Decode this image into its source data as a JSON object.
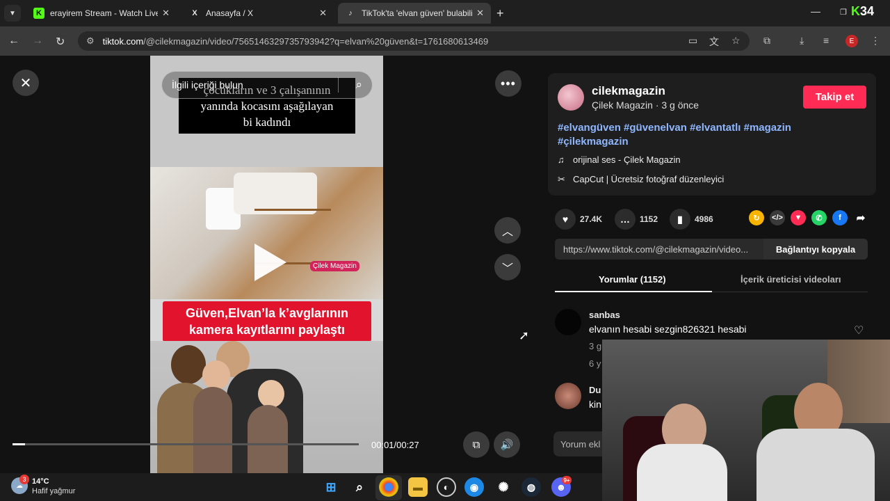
{
  "browser": {
    "tabs": [
      {
        "title": "erayirem Stream - Watch Live o",
        "favicon": "K",
        "favicon_color": "#53fc18"
      },
      {
        "title": "Anasayfa / X",
        "favicon": "X",
        "favicon_color": "#ffffff"
      },
      {
        "title": "TikTok'ta 'elvan güven' bulabilir",
        "favicon": "♪",
        "favicon_color": "#ffffff"
      }
    ],
    "url_host": "tiktok.com",
    "url_path": "/@cilekmagazin/video/7565146329735793942?q=elvan%20güven&t=1761680613469",
    "profile_initial": "E",
    "brand_logo_k": "K",
    "brand_logo_34": "34"
  },
  "video": {
    "search_placeholder": "İlgili içeriği bulun",
    "caption_lines": [
      "çocukların ve 3 çalışanının",
      "yanında kocasını aşağılayan",
      "bi kadındı"
    ],
    "watermark": "Çilek Magazin",
    "headline_lines": [
      "Güven,Elvan’la k’avglarının",
      "kamera kayıtlarını paylaştı"
    ],
    "time": "00:01/00:27",
    "progress": 0.037
  },
  "post": {
    "username": "cilekmagazin",
    "subtitle": "Çilek Magazin · 3 g önce",
    "follow_label": "Takip et",
    "hashtags": "#elvangüven #güvenelvan #elvantatlı #magazin #çilekmagazin",
    "sound": "orijinal ses - Çilek Magazin",
    "capcut": "CapCut | Ücretsiz fotoğraf düzenleyici",
    "likes": "27.4K",
    "comments": "1152",
    "saves": "4986",
    "link": "https://www.tiktok.com/@cilekmagazin/video...",
    "copy_label": "Bağlantıyı kopyala",
    "tab_comments": "Yorumlar (1152)",
    "tab_creator": "İçerik üreticisi videoları",
    "add_comment": "Yorum ekl"
  },
  "comments": [
    {
      "user": "sanbas",
      "text": "elvanın hesabi sezgin826321 hesabi",
      "meta1": "3 g",
      "meta2": "6 y"
    },
    {
      "user": "Du",
      "text": "kin"
    }
  ],
  "taskbar": {
    "temp": "14°C",
    "condition": "Hafif yağmur",
    "weather_badge": "3",
    "discord_badge": "9+"
  },
  "colors": {
    "accent": "#fe2c55",
    "hashtag": "#8fb7ff",
    "headline_red": "#e2142d"
  }
}
